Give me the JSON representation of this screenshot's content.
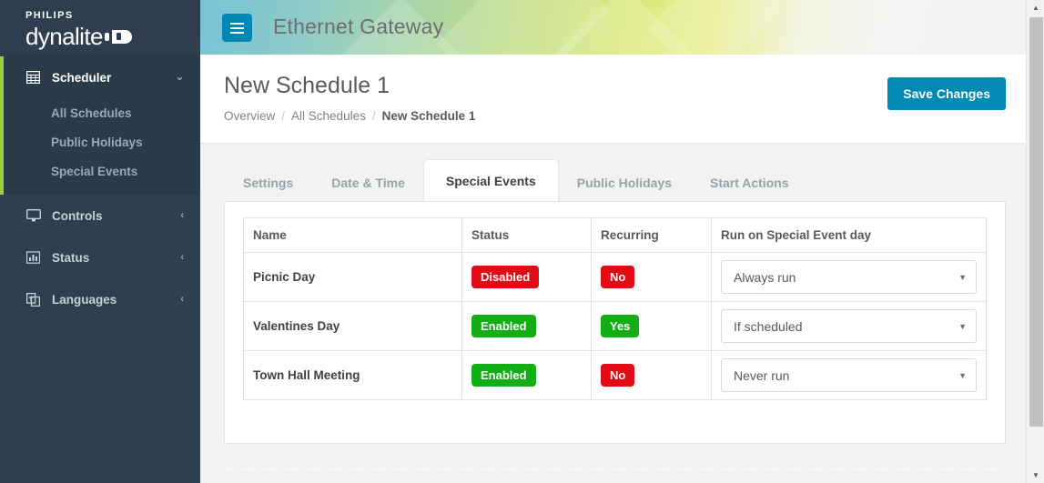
{
  "sidebar": {
    "logo": {
      "brand": "PHILIPS",
      "product": "dynalite"
    },
    "sections": [
      {
        "label": "Scheduler",
        "icon": "calendar-grid-icon",
        "caret": "⌄",
        "expanded": true,
        "children": [
          "All Schedules",
          "Public Holidays",
          "Special Events"
        ]
      },
      {
        "label": "Controls",
        "icon": "monitor-icon",
        "caret": "‹",
        "expanded": false,
        "children": []
      },
      {
        "label": "Status",
        "icon": "bar-chart-icon",
        "caret": "‹",
        "expanded": false,
        "children": []
      },
      {
        "label": "Languages",
        "icon": "translate-icon",
        "caret": "‹",
        "expanded": false,
        "children": []
      }
    ]
  },
  "topbar": {
    "menu_icon": "hamburger-icon",
    "title": "Ethernet Gateway"
  },
  "page": {
    "title": "New Schedule 1",
    "breadcrumb": [
      {
        "label": "Overview",
        "current": false
      },
      {
        "label": "All Schedules",
        "current": false
      },
      {
        "label": "New Schedule 1",
        "current": true
      }
    ],
    "breadcrumb_separator": "/",
    "save_label": "Save Changes"
  },
  "tabs": [
    {
      "label": "Settings",
      "active": false
    },
    {
      "label": "Date & Time",
      "active": false
    },
    {
      "label": "Special Events",
      "active": true
    },
    {
      "label": "Public Holidays",
      "active": false
    },
    {
      "label": "Start Actions",
      "active": false
    }
  ],
  "table": {
    "columns": [
      "Name",
      "Status",
      "Recurring",
      "Run on Special Event day"
    ],
    "rows": [
      {
        "name": "Picnic Day",
        "status": "Disabled",
        "status_color": "red",
        "recurring": "No",
        "recurring_color": "red",
        "run_value": "Always run"
      },
      {
        "name": "Valentines Day",
        "status": "Enabled",
        "status_color": "green",
        "recurring": "Yes",
        "recurring_color": "green",
        "run_value": "If scheduled"
      },
      {
        "name": "Town Hall Meeting",
        "status": "Enabled",
        "status_color": "green",
        "recurring": "No",
        "recurring_color": "red",
        "run_value": "Never run"
      }
    ],
    "run_options": [
      "Always run",
      "If scheduled",
      "Never run"
    ],
    "select_caret": "▼"
  },
  "colors": {
    "sidebar_bg": "#2f3f4f",
    "accent_green": "#9bcf3f",
    "brand_blue": "#0089b3",
    "badge_red": "#e00b15",
    "badge_green": "#13ad16"
  },
  "scrollbar": {
    "up": "▲",
    "down": "▼"
  }
}
